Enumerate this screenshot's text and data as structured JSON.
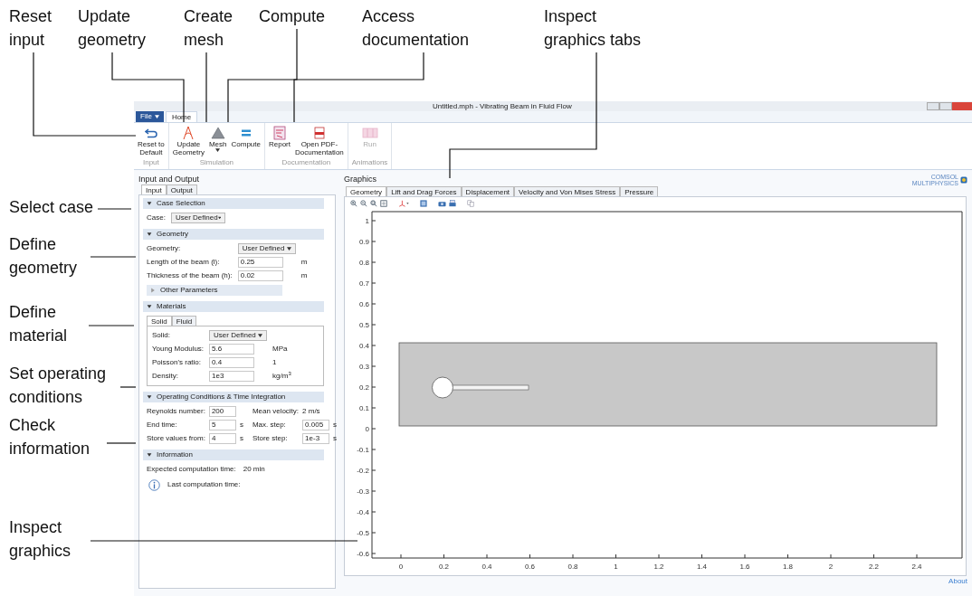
{
  "annotations": [
    {
      "lines": [
        "Reset",
        "input"
      ]
    },
    {
      "lines": [
        "Update",
        "geometry"
      ]
    },
    {
      "lines": [
        "Create",
        "mesh"
      ]
    },
    {
      "lines": [
        "Compute"
      ]
    },
    {
      "lines": [
        "Access",
        "documentation"
      ]
    },
    {
      "lines": [
        "Inspect",
        "graphics tabs"
      ]
    },
    {
      "lines": [
        "Select case"
      ]
    },
    {
      "lines": [
        "Define",
        "geometry"
      ]
    },
    {
      "lines": [
        "Define",
        "material"
      ]
    },
    {
      "lines": [
        "Set operating",
        "conditions"
      ]
    },
    {
      "lines": [
        "Check",
        "information"
      ]
    },
    {
      "lines": [
        "Inspect",
        "graphics"
      ]
    }
  ],
  "window": {
    "title": "Untitled.mph - Vibrating Beam in Fluid Flow"
  },
  "file_menu": {
    "label": "File"
  },
  "ribbon_tabs": [
    {
      "label": "Home",
      "selected": true
    }
  ],
  "ribbon_groups": [
    {
      "label": "Input",
      "buttons": [
        {
          "kind": "reset",
          "lines": [
            "Reset to",
            "Default"
          ],
          "disabled": false,
          "dropdown": false
        }
      ]
    },
    {
      "label": "Simulation",
      "buttons": [
        {
          "kind": "geometry",
          "lines": [
            "Update",
            "Geometry"
          ],
          "disabled": false,
          "dropdown": false
        },
        {
          "kind": "mesh",
          "lines": [
            "Mesh"
          ],
          "disabled": false,
          "dropdown": true
        },
        {
          "kind": "compute",
          "lines": [
            "Compute"
          ],
          "disabled": false,
          "dropdown": false
        }
      ]
    },
    {
      "label": "Documentation",
      "buttons": [
        {
          "kind": "report",
          "lines": [
            "Report"
          ],
          "disabled": false,
          "dropdown": false
        },
        {
          "kind": "pdf",
          "lines": [
            "Open PDF-",
            "Documentation"
          ],
          "disabled": false,
          "dropdown": false
        }
      ]
    },
    {
      "label": "Animations",
      "buttons": [
        {
          "kind": "run",
          "lines": [
            "Run"
          ],
          "disabled": true,
          "dropdown": false
        }
      ]
    }
  ],
  "left_panel": {
    "title": "Input and Output",
    "tabs": [
      {
        "label": "Input",
        "selected": true
      },
      {
        "label": "Output",
        "selected": false
      }
    ],
    "sections": [
      {
        "title": "Case Selection",
        "expanded": true,
        "rows": [
          {
            "kind": "dropdown",
            "label": "Case:",
            "value": "User Defined"
          }
        ]
      },
      {
        "title": "Geometry",
        "expanded": true,
        "rows": [
          {
            "kind": "dropdown",
            "label": "Geometry:",
            "value": "User Defined"
          },
          {
            "kind": "field",
            "label": "Length of the beam (l):",
            "value": "0.25",
            "unit": "m"
          },
          {
            "kind": "field",
            "label": "Thickness of the beam (h):",
            "value": "0.02",
            "unit": "m"
          },
          {
            "kind": "subsection",
            "title": "Other Parameters",
            "expanded": false
          }
        ]
      },
      {
        "title": "Materials",
        "expanded": true,
        "tabs": [
          {
            "label": "Solid",
            "selected": true
          },
          {
            "label": "Fluid",
            "selected": false
          }
        ],
        "rows": [
          {
            "kind": "dropdown",
            "label": "Solid:",
            "value": "User Defined"
          },
          {
            "kind": "field",
            "label": "Young Modulus:",
            "value": "5.6",
            "unit": "MPa"
          },
          {
            "kind": "field",
            "label": "Poisson's ratio:",
            "value": "0.4",
            "unit": "1"
          },
          {
            "kind": "field",
            "label": "Density:",
            "value": "1e3",
            "unit": "kg/m$^{3}$"
          }
        ]
      },
      {
        "title": "Operating Conditions & Time Integration",
        "expanded": true,
        "rows": [
          {
            "kind": "pair",
            "cells": [
              {
                "kind": "field",
                "label": "Reynolds number:",
                "value": "200"
              },
              {
                "kind": "readout",
                "label": "Mean velocity:",
                "value": "2 m/s"
              }
            ]
          },
          {
            "kind": "pair",
            "cells": [
              {
                "kind": "field",
                "label": "End time:",
                "value": "5",
                "unit": "s"
              },
              {
                "kind": "field",
                "label": "Max. step:",
                "value": "0.005",
                "unit": "s"
              }
            ]
          },
          {
            "kind": "pair",
            "cells": [
              {
                "kind": "field",
                "label": "Store values from:",
                "value": "4",
                "unit": "s"
              },
              {
                "kind": "field",
                "label": "Store step:",
                "value": "1e-3",
                "unit": "s"
              }
            ]
          }
        ]
      },
      {
        "title": "Information",
        "expanded": true,
        "rows": [
          {
            "kind": "readout",
            "label": "Expected computation time:",
            "value": "20 min"
          },
          {
            "kind": "info",
            "text": "Last computation time:"
          }
        ]
      }
    ]
  },
  "graphics": {
    "title": "Graphics",
    "logo": [
      "COMSOL",
      "MULTIPHYSICS"
    ],
    "tabs": [
      {
        "label": "Geometry",
        "selected": true
      },
      {
        "label": "Lift and Drag Forces",
        "selected": false
      },
      {
        "label": "Displacement",
        "selected": false
      },
      {
        "label": "Velocity and Von Mises Stress",
        "selected": false
      },
      {
        "label": "Pressure",
        "selected": false
      }
    ],
    "xticks": [
      "0",
      "0.2",
      "0.4",
      "0.6",
      "0.8",
      "1",
      "1.2",
      "1.4",
      "1.6",
      "1.8",
      "2",
      "2.2",
      "2.4"
    ],
    "yticks": [
      "1",
      "0.9",
      "0.8",
      "0.7",
      "0.6",
      "0.5",
      "0.4",
      "0.3",
      "0.2",
      "0.1",
      "0",
      "-0.1",
      "-0.2",
      "-0.3",
      "-0.4",
      "-0.5",
      "-0.6"
    ]
  },
  "footer": {
    "link": "About"
  }
}
